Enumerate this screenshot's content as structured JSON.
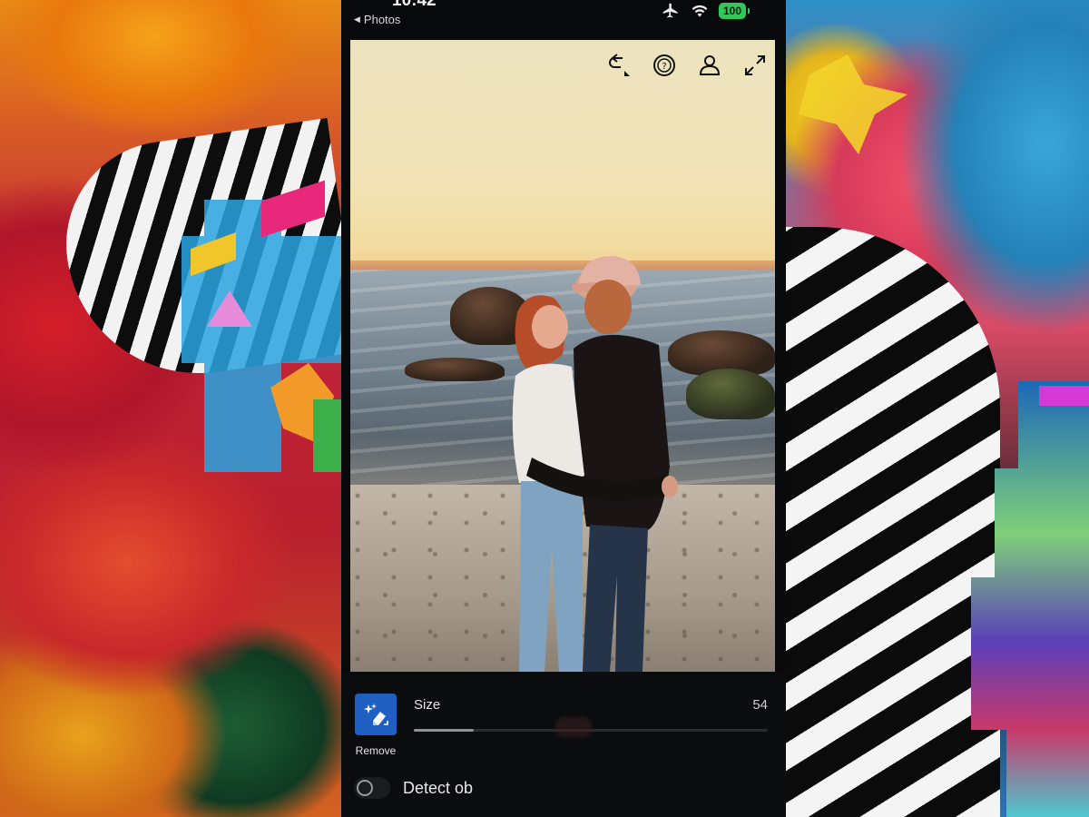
{
  "status_bar": {
    "time": "10:42",
    "back_label": "Photos",
    "battery": "100"
  },
  "photo_toolbar": {
    "icons": [
      "undo-redo-icon",
      "help-icon",
      "person-icon",
      "expand-icon"
    ]
  },
  "tool_panel": {
    "tool_label": "Remove",
    "size_label": "Size",
    "size_value": "54",
    "size_level_fraction": 0.17,
    "detect_label": "Detect ob"
  },
  "colors": {
    "accent": "#1f5fc2",
    "battery": "#33c759",
    "panel": "#0b0c0e"
  }
}
